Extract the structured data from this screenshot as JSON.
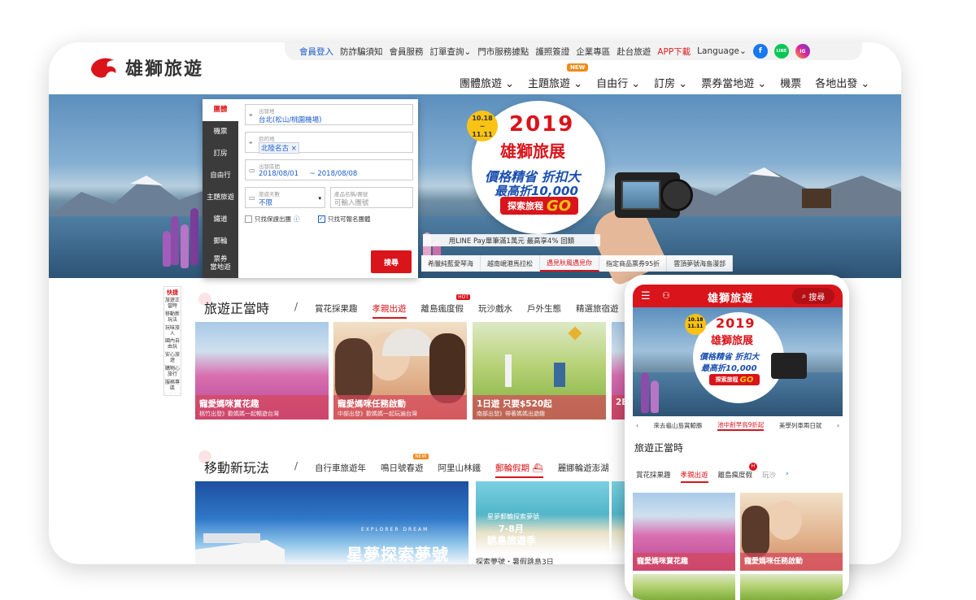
{
  "brand": {
    "name": "雄獅旅遊",
    "red": "#d9141b"
  },
  "topbar": {
    "items": [
      "會員登入",
      "防詐騙須知",
      "會員服務",
      "訂單查詢",
      "門市服務據點",
      "護照簽證",
      "企業專區",
      "赴台旅遊",
      "APP下載",
      "Language"
    ],
    "social": [
      "f",
      "LINE",
      "IG"
    ]
  },
  "mainnav": {
    "items": [
      "團體旅遊",
      "主題旅遊",
      "自由行",
      "訂房",
      "票券當地遊",
      "機票",
      "各地出發"
    ],
    "new_badge": "NEW"
  },
  "search": {
    "tabs": [
      "團體",
      "機票",
      "訂房",
      "自由行",
      "主題旅遊",
      "鐵道",
      "郵輪",
      "票券\n當地遊"
    ],
    "origin_label": "出發地",
    "origin_value": "台北(松山/桃園機場)",
    "dest_label": "目的地",
    "dest_value": "北陸名古",
    "date_label": "出發區間",
    "date_from": "2018/08/01",
    "date_to": "2018/08/08",
    "days_label": "旅遊天數",
    "days_value": "不限",
    "product_label": "產品名稱/團號",
    "product_placeholder": "可輸入團號",
    "check1": "只找保證出團",
    "check2": "只找可報名團體",
    "button": "搜尋"
  },
  "promo": {
    "date_top": "10.18",
    "date_mid": "~",
    "date_bottom": "11.11",
    "year": "2019",
    "title": "雄獅旅展",
    "line1": "價格精省 折扣大",
    "line2": "最高折10,000",
    "btn_text": "探索旅程",
    "btn_go": "GO",
    "linepay": "用LINE Pay單筆滿1萬元 最高享4% 回饋"
  },
  "hero_tabs": [
    "希臘純藍愛琴海",
    "越南峴港馬拉松",
    "遇見秋風遇見你",
    "指定商品票券95折",
    "雲頂夢號海島漫部"
  ],
  "quick": [
    "快捷",
    "旅遊正當時",
    "移動新玩法",
    "玩味旅人",
    "國內自由玩",
    "安心旅遊",
    "購物心旅行",
    "服務專區"
  ],
  "section1": {
    "title": "旅遊正當時",
    "tabs": [
      "賞花採果趣",
      "孝親出遊",
      "離島瘋度假",
      "玩沙戲水",
      "戶外生態",
      "精選旅宿遊"
    ],
    "hot": "HOT",
    "cards": [
      {
        "title": "寵愛媽咪賞花趣",
        "sub": "桃竹出發》歡媽媽一起暢遊台灣"
      },
      {
        "title": "寵愛媽咪任務啟動",
        "sub": "中部出發》歡媽媽一起玩遍台灣"
      },
      {
        "title": "1日遊 只要$520起",
        "sub": "南部出發》帶著媽媽出遊趣"
      },
      {
        "title": "2E",
        "sub": ""
      }
    ]
  },
  "section2": {
    "title": "移動新玩法",
    "tabs": [
      "自行車旅遊年",
      "鳴日號春遊",
      "阿里山林鐵",
      "郵輪假期",
      "麗娜輪遊澎湖"
    ],
    "new": "NEW",
    "cruise_sub": "EXPLORER DREAM",
    "cruise_title": "星夢探索夢號",
    "beach_small": "星夢郵輪探索夢號",
    "beach_date": "7-8月",
    "beach_title": "跳島旅遊季",
    "beach_caption": "探索夢號・暑假跳島3日"
  },
  "phone": {
    "search": "搜尋",
    "tabs": [
      "來去龜山島賞鯨豚",
      "池中創早鳥9折起",
      "美學列車兩日就"
    ],
    "section": "旅遊正當時",
    "cats": [
      "賞花採果趣",
      "孝親出遊",
      "離島瘋度假",
      "玩沙"
    ],
    "cards": [
      "寵愛媽咪賞花趣",
      "寵愛媽咪任務啟動"
    ]
  }
}
